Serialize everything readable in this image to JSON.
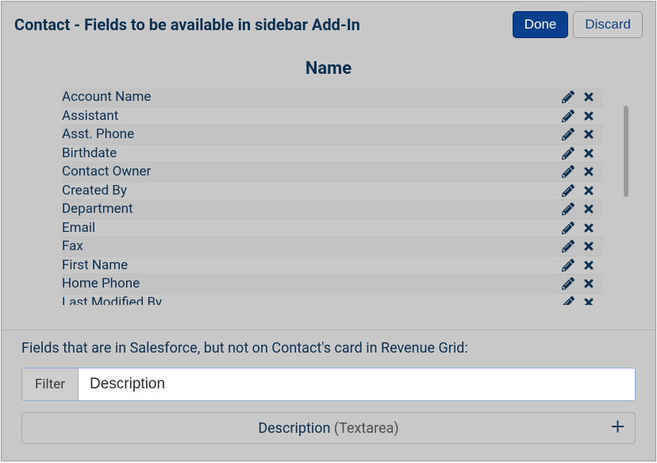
{
  "header": {
    "title": "Contact - Fields to be available in sidebar Add-In",
    "done_label": "Done",
    "discard_label": "Discard"
  },
  "list": {
    "column_header": "Name",
    "fields": [
      "Account Name",
      "Assistant",
      "Asst. Phone",
      "Birthdate",
      "Contact Owner",
      "Created By",
      "Department",
      "Email",
      "Fax",
      "First Name",
      "Home Phone",
      "Last Modified By"
    ]
  },
  "bottom": {
    "label": "Fields that are in Salesforce, but not on Contact's card in Revenue Grid:",
    "filter_label": "Filter",
    "filter_value": "Description",
    "result_name": "Description",
    "result_type": "(Textarea)"
  }
}
